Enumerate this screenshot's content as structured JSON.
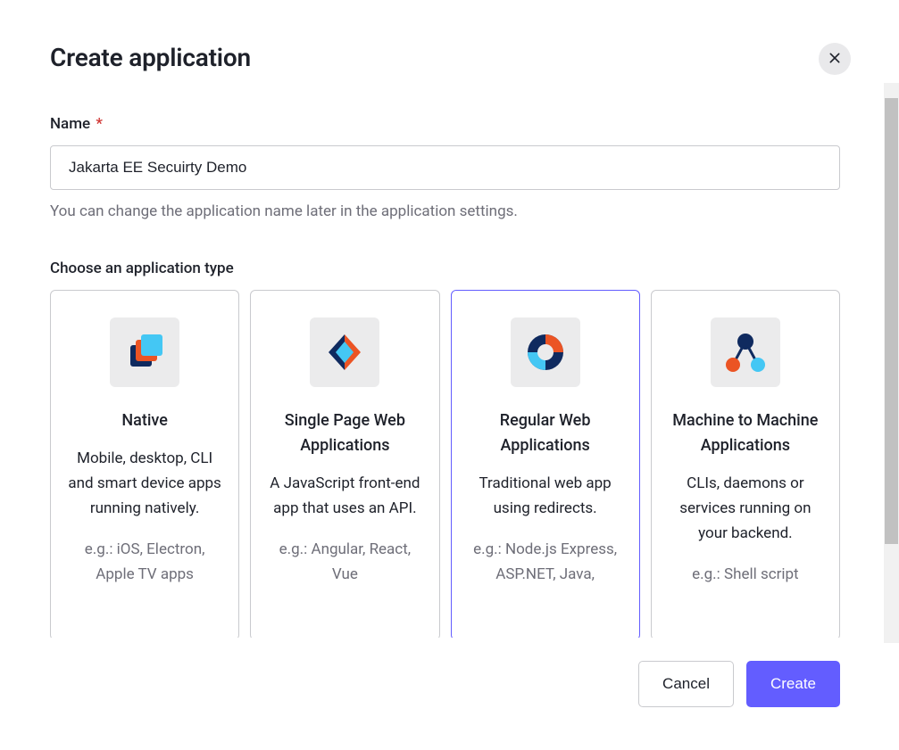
{
  "modal": {
    "title": "Create application",
    "nameField": {
      "label": "Name",
      "required": "*",
      "value": "Jakarta EE Secuirty Demo",
      "help": "You can change the application name later in the application settings."
    },
    "typeSection": {
      "label": "Choose an application type",
      "selectedIndex": 2,
      "options": [
        {
          "title": "Native",
          "desc": "Mobile, desktop, CLI and smart device apps running natively.",
          "eg": "e.g.: iOS, Electron, Apple TV apps",
          "iconName": "native-icon"
        },
        {
          "title": "Single Page Web Applications",
          "desc": "A JavaScript front-end app that uses an API.",
          "eg": "e.g.: Angular, React, Vue",
          "iconName": "spa-icon"
        },
        {
          "title": "Regular Web Applications",
          "desc": "Traditional web app using redirects.",
          "eg": "e.g.: Node.js Express, ASP.NET, Java,",
          "iconName": "regular-web-icon"
        },
        {
          "title": "Machine to Machine Applications",
          "desc": "CLIs, daemons or services running on your backend.",
          "eg": "e.g.: Shell script",
          "iconName": "m2m-icon"
        }
      ]
    },
    "footer": {
      "cancel": "Cancel",
      "create": "Create"
    }
  }
}
